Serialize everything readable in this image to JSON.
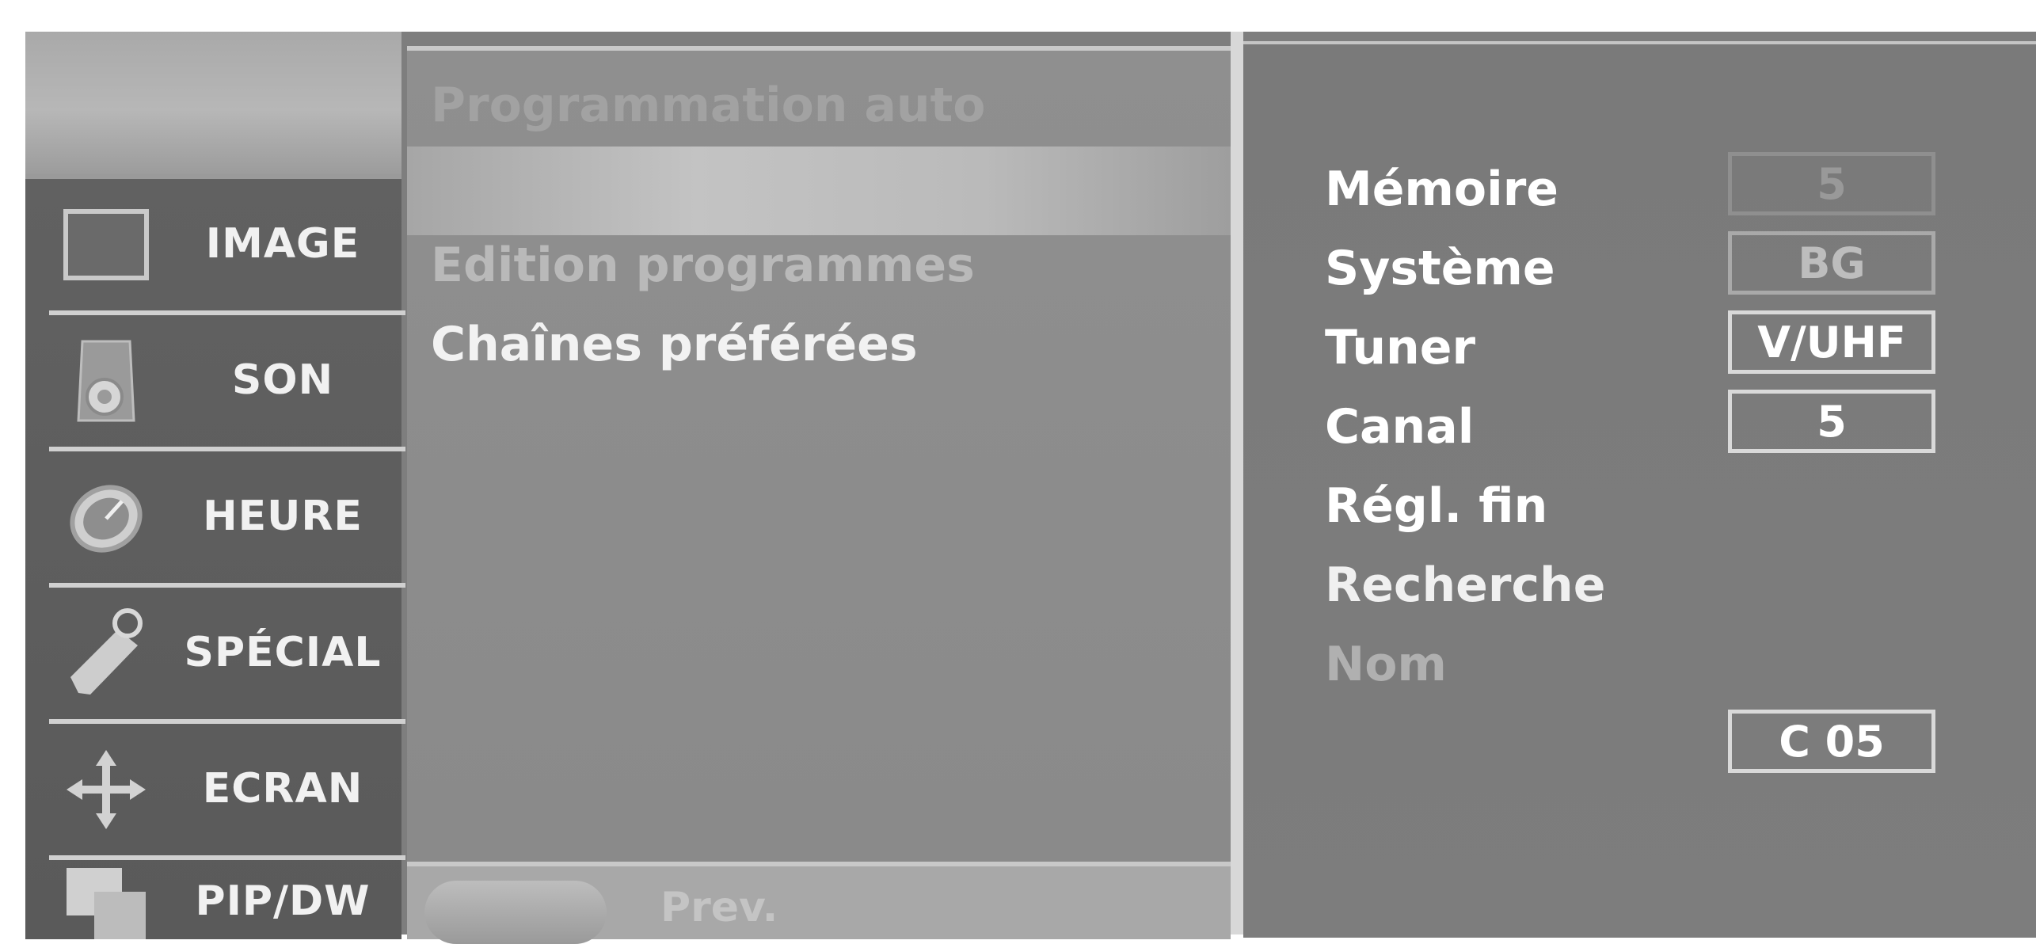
{
  "left_menu": {
    "items": [
      {
        "label": "IMAGE",
        "icon": "image-icon"
      },
      {
        "label": "SON",
        "icon": "speaker-icon"
      },
      {
        "label": "HEURE",
        "icon": "clock-icon"
      },
      {
        "label": "SPÉCIAL",
        "icon": "tag-icon"
      },
      {
        "label": "ECRAN",
        "icon": "move-arrows-icon"
      },
      {
        "label": "PIP/DW",
        "icon": "pip-icon"
      }
    ],
    "selected_index": 0
  },
  "submenu": {
    "items": [
      {
        "label": "Programmation auto"
      },
      {
        "label": ""
      },
      {
        "label": "Edition programmes"
      },
      {
        "label": "Chaînes préférées"
      }
    ],
    "selected_index": 1,
    "footer": {
      "prev_label": "Prev."
    }
  },
  "settings": {
    "rows": [
      {
        "label": "Mémoire",
        "value": "5"
      },
      {
        "label": "Système",
        "value": "BG"
      },
      {
        "label": "Tuner",
        "value": "V/UHF"
      },
      {
        "label": "Canal",
        "value": "5"
      },
      {
        "label": "Régl. fin",
        "value": ""
      },
      {
        "label": "Recherche",
        "value": ""
      },
      {
        "label": "Nom",
        "value": ""
      }
    ],
    "channel_name": "C 05"
  },
  "colors": {
    "background": "#7e7e7e",
    "text_active": "#ffffff",
    "text_dim": "#b5b5b5"
  }
}
